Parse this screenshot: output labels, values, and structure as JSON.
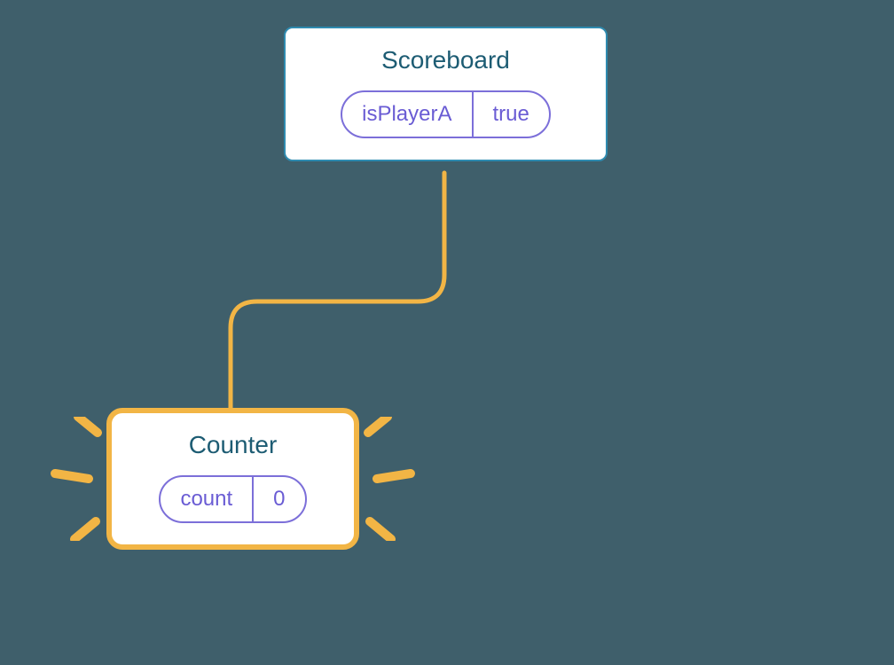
{
  "parent": {
    "title": "Scoreboard",
    "state": {
      "key": "isPlayerA",
      "value": "true"
    }
  },
  "child": {
    "title": "Counter",
    "state": {
      "key": "count",
      "value": "0"
    }
  },
  "colors": {
    "background": "#3f5f6b",
    "parentBorder": "#2f8bb0",
    "childBorder": "#f2b545",
    "titleText": "#1d5c73",
    "pillBorder": "#7c6fd9",
    "pillText": "#6a5cd4",
    "connector": "#f2b545"
  }
}
